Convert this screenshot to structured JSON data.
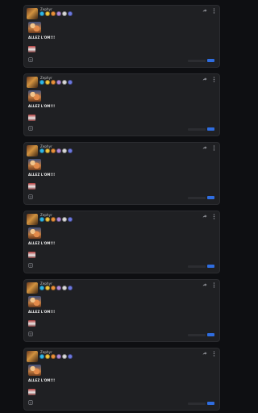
{
  "colors": {
    "background": "#0e0f12",
    "card": "#1f2023",
    "card_border": "#2b2c30",
    "accent": "#2f6de0"
  },
  "badge_colors": [
    "#2fb7e8",
    "#f2c53d",
    "#e8903a",
    "#b08ad8",
    "#d9d9d9",
    "#6c78e0"
  ],
  "posts": [
    {
      "username": "Zephyr",
      "text": "ALLEZ L'OM!!!",
      "icons": {
        "share": "share-icon",
        "more": "more-vertical-icon",
        "footer": "emoji-icon"
      }
    },
    {
      "username": "Zephyr",
      "text": "ALLEZ L'OM!!!",
      "icons": {
        "share": "share-icon",
        "more": "more-vertical-icon",
        "footer": "emoji-icon"
      }
    },
    {
      "username": "Zephyr",
      "text": "ALLEZ L'OM!!!",
      "icons": {
        "share": "share-icon",
        "more": "more-vertical-icon",
        "footer": "emoji-icon"
      }
    },
    {
      "username": "Zephyr",
      "text": "ALLEZ L'OM!!!",
      "icons": {
        "share": "share-icon",
        "more": "more-vertical-icon",
        "footer": "emoji-icon"
      }
    },
    {
      "username": "Zephyr",
      "text": "ALLEZ L'OM!!!",
      "icons": {
        "share": "share-icon",
        "more": "more-vertical-icon",
        "footer": "emoji-icon"
      }
    },
    {
      "username": "Zephyr",
      "text": "ALLEZ L'OM!!!",
      "icons": {
        "share": "share-icon",
        "more": "more-vertical-icon",
        "footer": "emoji-icon"
      }
    }
  ]
}
